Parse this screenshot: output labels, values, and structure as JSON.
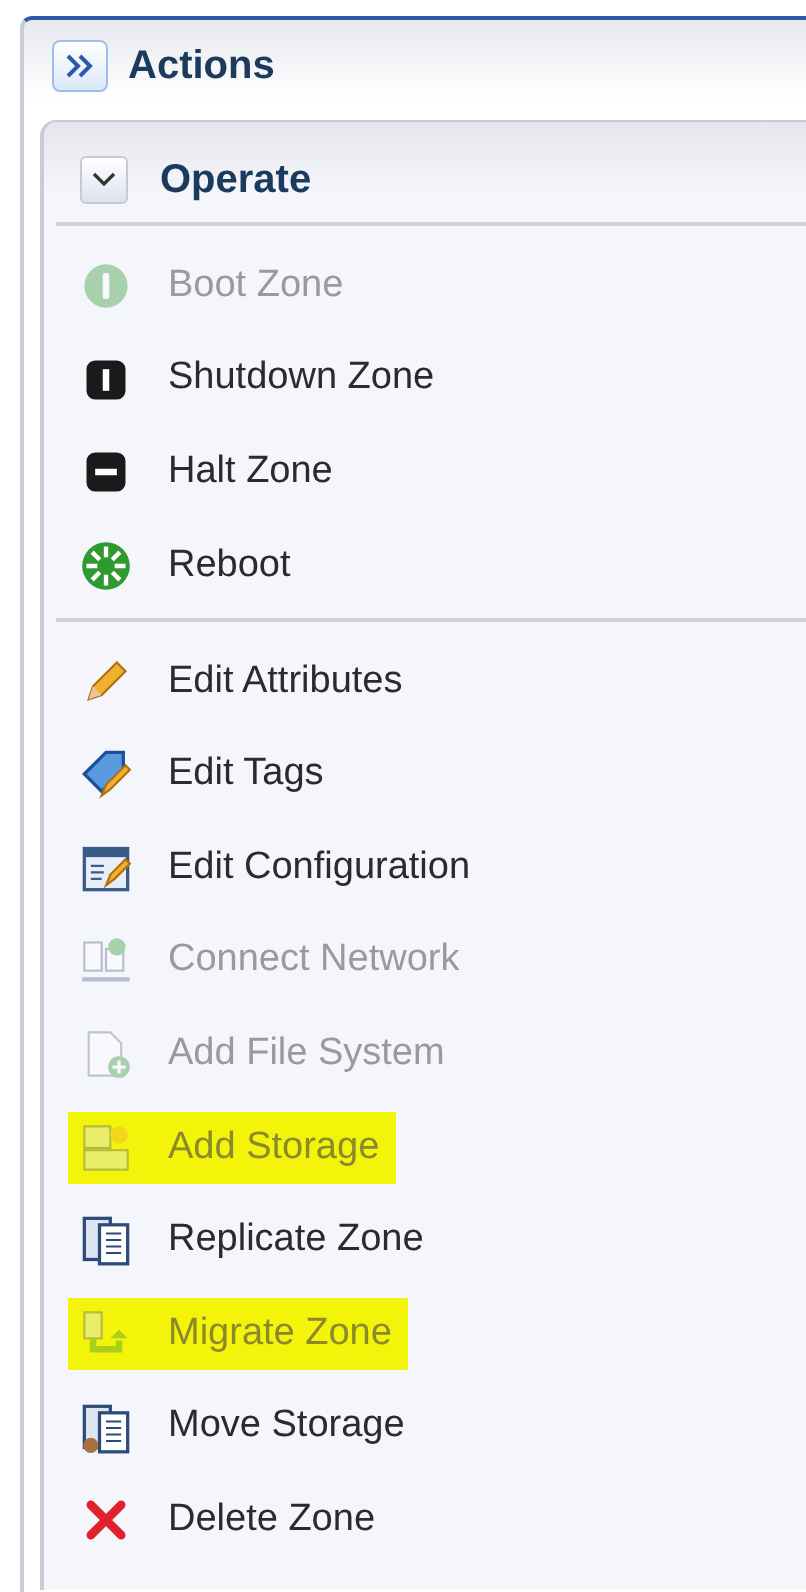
{
  "panel": {
    "title": "Actions"
  },
  "section": {
    "title": "Operate",
    "expanded": true
  },
  "groups": [
    {
      "items": [
        {
          "label": "Boot Zone",
          "kind": "boot",
          "disabled": true,
          "highlighted": false
        },
        {
          "label": "Shutdown Zone",
          "kind": "shutdown",
          "disabled": false,
          "highlighted": false
        },
        {
          "label": "Halt Zone",
          "kind": "halt",
          "disabled": false,
          "highlighted": false
        },
        {
          "label": "Reboot",
          "kind": "reboot",
          "disabled": false,
          "highlighted": false
        }
      ]
    },
    {
      "items": [
        {
          "label": "Edit Attributes",
          "kind": "pencil",
          "disabled": false,
          "highlighted": false
        },
        {
          "label": "Edit Tags",
          "kind": "tag",
          "disabled": false,
          "highlighted": false
        },
        {
          "label": "Edit Configuration",
          "kind": "config",
          "disabled": false,
          "highlighted": false
        },
        {
          "label": "Connect Network",
          "kind": "network",
          "disabled": true,
          "highlighted": false
        },
        {
          "label": "Add File System",
          "kind": "filesystem",
          "disabled": true,
          "highlighted": false
        },
        {
          "label": "Add Storage",
          "kind": "storage",
          "disabled": true,
          "highlighted": true
        },
        {
          "label": "Replicate Zone",
          "kind": "replicate",
          "disabled": false,
          "highlighted": false
        },
        {
          "label": "Migrate Zone",
          "kind": "migrate",
          "disabled": true,
          "highlighted": true
        },
        {
          "label": "Move Storage",
          "kind": "move",
          "disabled": false,
          "highlighted": false
        },
        {
          "label": "Delete Zone",
          "kind": "delete",
          "disabled": false,
          "highlighted": false
        }
      ]
    }
  ]
}
